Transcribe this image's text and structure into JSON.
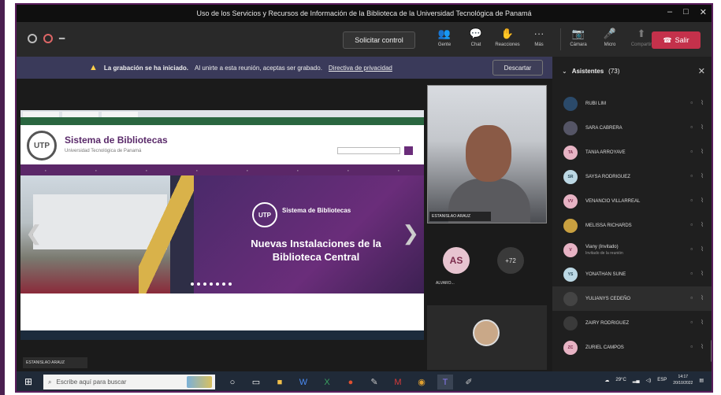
{
  "window": {
    "title": "Uso de los Servicios y Recursos de Información de la Biblioteca de la Universidad Tecnológica de Panamá",
    "controls": [
      "–",
      "□",
      "✕"
    ]
  },
  "toolbar": {
    "request_control": "Solicitar control",
    "items": [
      {
        "label": "Gente",
        "icon": "people-icon",
        "glyph": "👥"
      },
      {
        "label": "Chat",
        "icon": "chat-icon",
        "glyph": "💬"
      },
      {
        "label": "Reacciones",
        "icon": "reactions-icon",
        "glyph": "✋"
      },
      {
        "label": "Más",
        "icon": "more-icon",
        "glyph": "···"
      }
    ],
    "media": [
      {
        "label": "Cámara",
        "icon": "camera-icon",
        "glyph": "📷"
      },
      {
        "label": "Micro",
        "icon": "mic-off-icon",
        "glyph": "🎤"
      },
      {
        "label": "Compartir",
        "icon": "share-icon",
        "glyph": "⬆"
      }
    ],
    "leave": "Salir"
  },
  "banner": {
    "bold": "La grabación se ha iniciado.",
    "text": "Al unirte a esta reunión, aceptas ser grabado.",
    "link": "Directiva de privacidad",
    "dismiss": "Descartar"
  },
  "shared_site": {
    "logo": "UTP",
    "title": "Sistema de Bibliotecas",
    "subtitle": "Universidad Tecnológica de Panamá",
    "slide_logo": "UTP",
    "slide_logo_text": "Sistema de Bibliotecas",
    "slide_heading": "Nuevas Instalaciones de la Biblioteca Central",
    "presenter": "ESTANISLAO ARAUZ"
  },
  "videos": {
    "speaker_name": "ESTANISLAO ARAUZ",
    "avatar_initials": "AS",
    "avatar_name": "ALVARO...",
    "more_count": "+72"
  },
  "panel": {
    "title": "Asistentes",
    "count": "(73)",
    "participants": [
      {
        "name": "RUBI LIM",
        "initials": "",
        "color": "#2b4a6a",
        "fg": "#9cf"
      },
      {
        "name": "SARA CABRERA",
        "initials": "",
        "color": "#556",
        "fg": "#ddd"
      },
      {
        "name": "TANIA ARROYAVE",
        "initials": "TA",
        "color": "#e7b3c4",
        "fg": "#7a2a4a"
      },
      {
        "name": "SAYSA RODRIGUEZ",
        "initials": "SR",
        "color": "#bcd8e4",
        "fg": "#2a4a5a"
      },
      {
        "name": "VENANCIO VILLARREAL",
        "initials": "VV",
        "color": "#e7b3c4",
        "fg": "#7a2a4a"
      },
      {
        "name": "MELISSA RICHARDS",
        "initials": "",
        "color": "#c9a040",
        "fg": "#222"
      },
      {
        "name": "Viany (Invitado)",
        "sub": "Invitado de la reunión",
        "initials": "V",
        "color": "#e7b3c4",
        "fg": "#7a2a4a"
      },
      {
        "name": "YONATHAN SUNE",
        "initials": "YS",
        "color": "#bcd8e4",
        "fg": "#2a4a5a"
      },
      {
        "name": "YULIANYS CEDEÑO",
        "initials": "",
        "color": "#444",
        "fg": "#ddd"
      },
      {
        "name": "ZAIRY RODRIGUEZ",
        "initials": "",
        "color": "#3a3a3a",
        "fg": "#ddd"
      },
      {
        "name": "ZURIEL CAMPOS",
        "initials": "ZC",
        "color": "#e7b3c4",
        "fg": "#7a2a4a"
      }
    ]
  },
  "taskbar": {
    "search_placeholder": "Escribe aquí para buscar",
    "temperature": "29°C",
    "language": "ESP",
    "time": "14:17",
    "date": "20/10/2022"
  }
}
